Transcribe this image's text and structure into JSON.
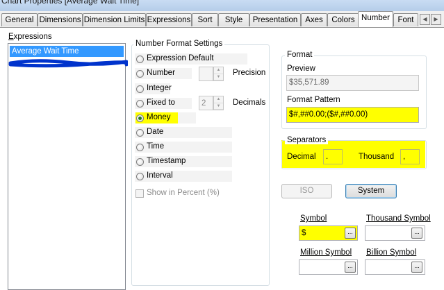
{
  "window": {
    "title": "Chart Properties [Average Wait Time]"
  },
  "tabs": [
    {
      "label": "General"
    },
    {
      "label": "Dimensions"
    },
    {
      "label": "Dimension Limits"
    },
    {
      "label": "Expressions"
    },
    {
      "label": "Sort"
    },
    {
      "label": "Style"
    },
    {
      "label": "Presentation"
    },
    {
      "label": "Axes"
    },
    {
      "label": "Colors"
    },
    {
      "label": "Number"
    },
    {
      "label": "Font"
    }
  ],
  "active_tab": "Number",
  "expressions": {
    "label": "Expressions",
    "items": [
      "Average Wait Time"
    ]
  },
  "number_format": {
    "legend": "Number Format Settings",
    "options": [
      "Expression Default",
      "Number",
      "Integer",
      "Fixed to",
      "Money",
      "Date",
      "Time",
      "Timestamp",
      "Interval"
    ],
    "selected": "Money",
    "precision_label": "Precision",
    "decimals_label": "Decimals",
    "decimals_value": "2",
    "show_percent": "Show in Percent (%)"
  },
  "format": {
    "legend": "Format",
    "preview_label": "Preview",
    "preview_value": "$35,571.89",
    "pattern_label": "Format Pattern",
    "pattern_value": "$#,##0.00;($#,##0.00)"
  },
  "separators": {
    "legend": "Separators",
    "decimal_label": "Decimal",
    "decimal_value": ".",
    "thousand_label": "Thousand",
    "thousand_value": ","
  },
  "buttons": {
    "iso": "ISO",
    "system": "System",
    "ellipsis": "..."
  },
  "symbols": {
    "symbol_label": "Symbol",
    "symbol_value": "$",
    "thousand_label": "Thousand Symbol",
    "million_label": "Million Symbol",
    "billion_label": "Billion Symbol"
  },
  "colors": {
    "highlight": "#ffff00",
    "selection": "#3399ff",
    "scribble": "#0033cc"
  }
}
